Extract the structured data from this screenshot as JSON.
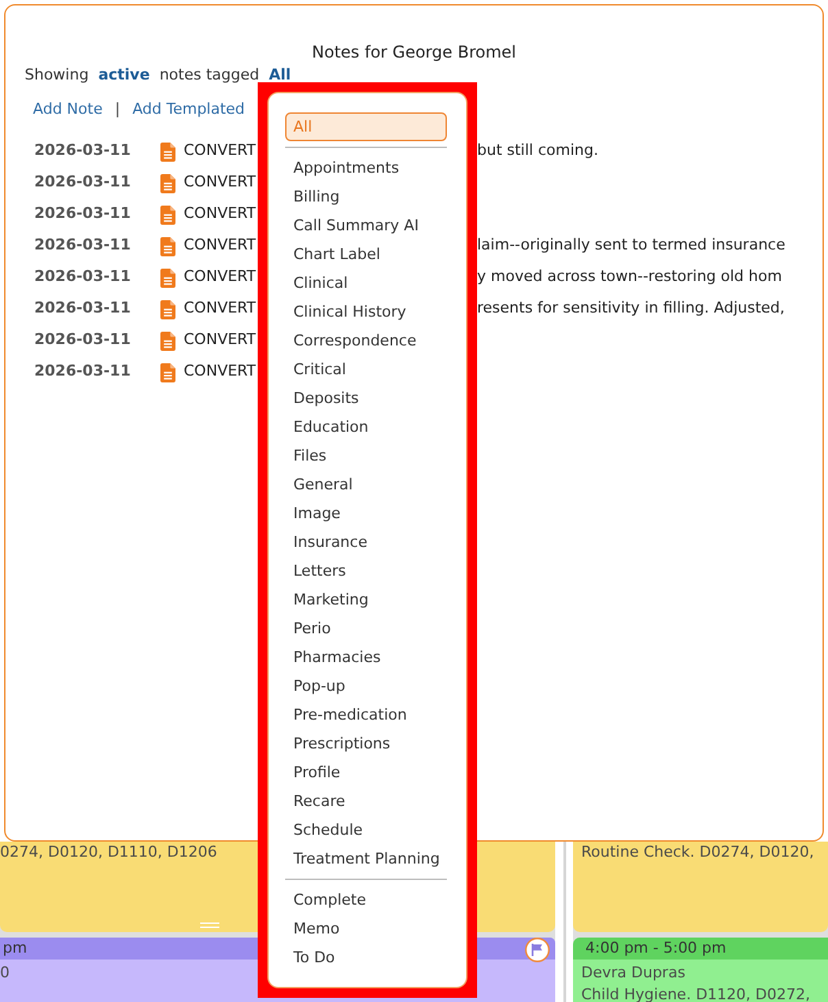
{
  "modal": {
    "title": "Notes for George Bromel",
    "filter": {
      "prefix": "Showing",
      "status": "active",
      "middle": "notes tagged",
      "tag": "All"
    },
    "actions": [
      {
        "label": "Add Note"
      },
      {
        "label": "Add Templated"
      }
    ],
    "action_separator": "|",
    "notes": [
      {
        "date": "2026-03-11",
        "title": "CONVERT",
        "text": "but still coming."
      },
      {
        "date": "2026-03-11",
        "title": "CONVERT"
      },
      {
        "date": "2026-03-11",
        "title": "CONVERT"
      },
      {
        "date": "2026-03-11",
        "title": "CONVERT",
        "text": "laim--originally sent to termed insurance"
      },
      {
        "date": "2026-03-11",
        "title": "CONVERT",
        "text": "y moved across town--restoring old hom"
      },
      {
        "date": "2026-03-11",
        "title": "CONVERT",
        "text": "resents for sensitivity in filling. Adjusted,"
      },
      {
        "date": "2026-03-11",
        "title": "CONVERT"
      },
      {
        "date": "2026-03-11",
        "title": "CONVERT"
      }
    ]
  },
  "tag_menu": {
    "groups": [
      {
        "items": [
          {
            "label": "All",
            "selected": true
          }
        ]
      },
      {
        "items": [
          {
            "label": "Appointments",
            "selected": false
          },
          {
            "label": "Billing",
            "selected": false
          },
          {
            "label": "Call Summary AI",
            "selected": false
          },
          {
            "label": "Chart Label",
            "selected": false
          },
          {
            "label": "Clinical",
            "selected": false
          },
          {
            "label": "Clinical History",
            "selected": false
          },
          {
            "label": "Correspondence",
            "selected": false
          },
          {
            "label": "Critical",
            "selected": false
          },
          {
            "label": "Deposits",
            "selected": false
          },
          {
            "label": "Education",
            "selected": false
          },
          {
            "label": "Files",
            "selected": false
          },
          {
            "label": "General",
            "selected": false
          },
          {
            "label": "Image",
            "selected": false
          },
          {
            "label": "Insurance",
            "selected": false
          },
          {
            "label": "Letters",
            "selected": false
          },
          {
            "label": "Marketing",
            "selected": false
          },
          {
            "label": "Perio",
            "selected": false
          },
          {
            "label": "Pharmacies",
            "selected": false
          },
          {
            "label": "Pop-up",
            "selected": false
          },
          {
            "label": "Pre-medication",
            "selected": false
          },
          {
            "label": "Prescriptions",
            "selected": false
          },
          {
            "label": "Profile",
            "selected": false
          },
          {
            "label": "Recare",
            "selected": false
          },
          {
            "label": "Schedule",
            "selected": false
          },
          {
            "label": "Treatment Planning",
            "selected": false
          }
        ]
      },
      {
        "items": [
          {
            "label": "Complete",
            "selected": false
          },
          {
            "label": "Memo",
            "selected": false
          },
          {
            "label": "To Do",
            "selected": false
          }
        ]
      }
    ]
  },
  "calendar": {
    "columns": [
      {
        "appointments": [
          {
            "color": "#f9dc74",
            "lines": [
              "0274, D0120, D1110, D1206"
            ],
            "resize_handle": true
          },
          {
            "header": {
              "text": "pm",
              "color": "#9b8cef"
            },
            "color": "#c6b8fc",
            "lines": [
              "0"
            ],
            "flagged": true
          }
        ]
      },
      {
        "appointments": [
          {
            "color": "#f9dc74",
            "lines": [
              "Routine Check. D0274, D0120,"
            ],
            "resize_handle": false
          },
          {
            "header": {
              "text": "4:00 pm - 5:00 pm",
              "color": "#5fd35f"
            },
            "color": "#90ef90",
            "lines": [
              "Devra Dupras",
              "Child Hygiene. D1120, D0272,"
            ],
            "flagged": false
          }
        ]
      }
    ]
  }
}
